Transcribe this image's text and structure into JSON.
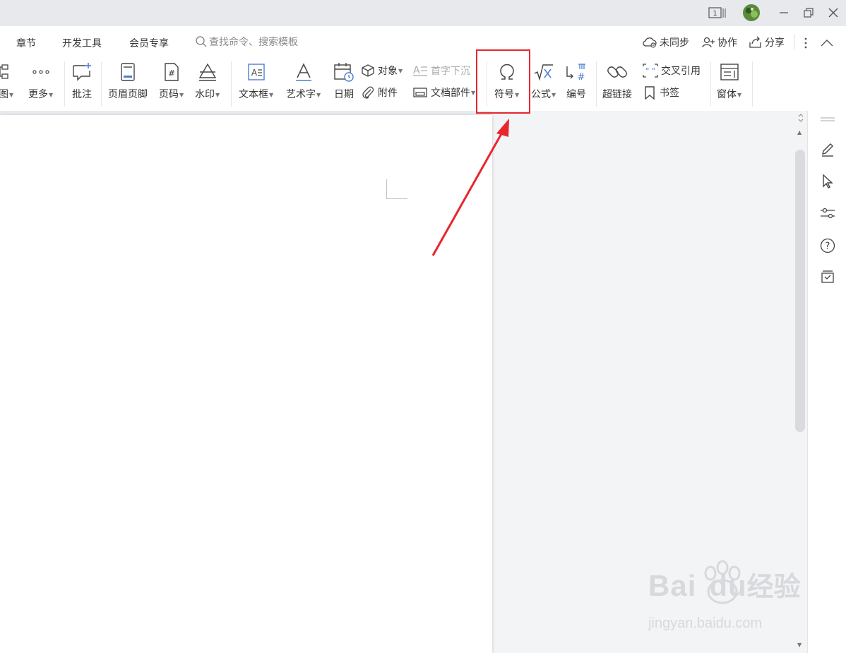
{
  "window": {
    "page_indicator": "1",
    "minimize": "–"
  },
  "menu": {
    "tabs": [
      "章节",
      "开发工具",
      "会员专享"
    ],
    "search_placeholder": "查找命令、搜索模板",
    "sync": "未同步",
    "collab": "协作",
    "share": "分享"
  },
  "ribbon": {
    "partial_graph": "导图",
    "more": "更多",
    "comment": "批注",
    "header_footer": "页眉页脚",
    "page_number": "页码",
    "watermark": "水印",
    "textbox": "文本框",
    "wordart": "艺术字",
    "date": "日期",
    "object": "对象",
    "attachment": "附件",
    "dropcap": "首字下沉",
    "doc_parts": "文档部件",
    "symbol": "符号",
    "formula": "公式",
    "numbering": "编号",
    "hyperlink": "超链接",
    "cross_ref": "交叉引用",
    "bookmark": "书签",
    "window": "窗体"
  },
  "watermark": {
    "brand": "Bai",
    "brand2": "du",
    "cn": "经验",
    "url": "jingyan.baidu.com"
  },
  "colors": {
    "accent": "#4a7fd4",
    "annotation": "#e8262c"
  }
}
